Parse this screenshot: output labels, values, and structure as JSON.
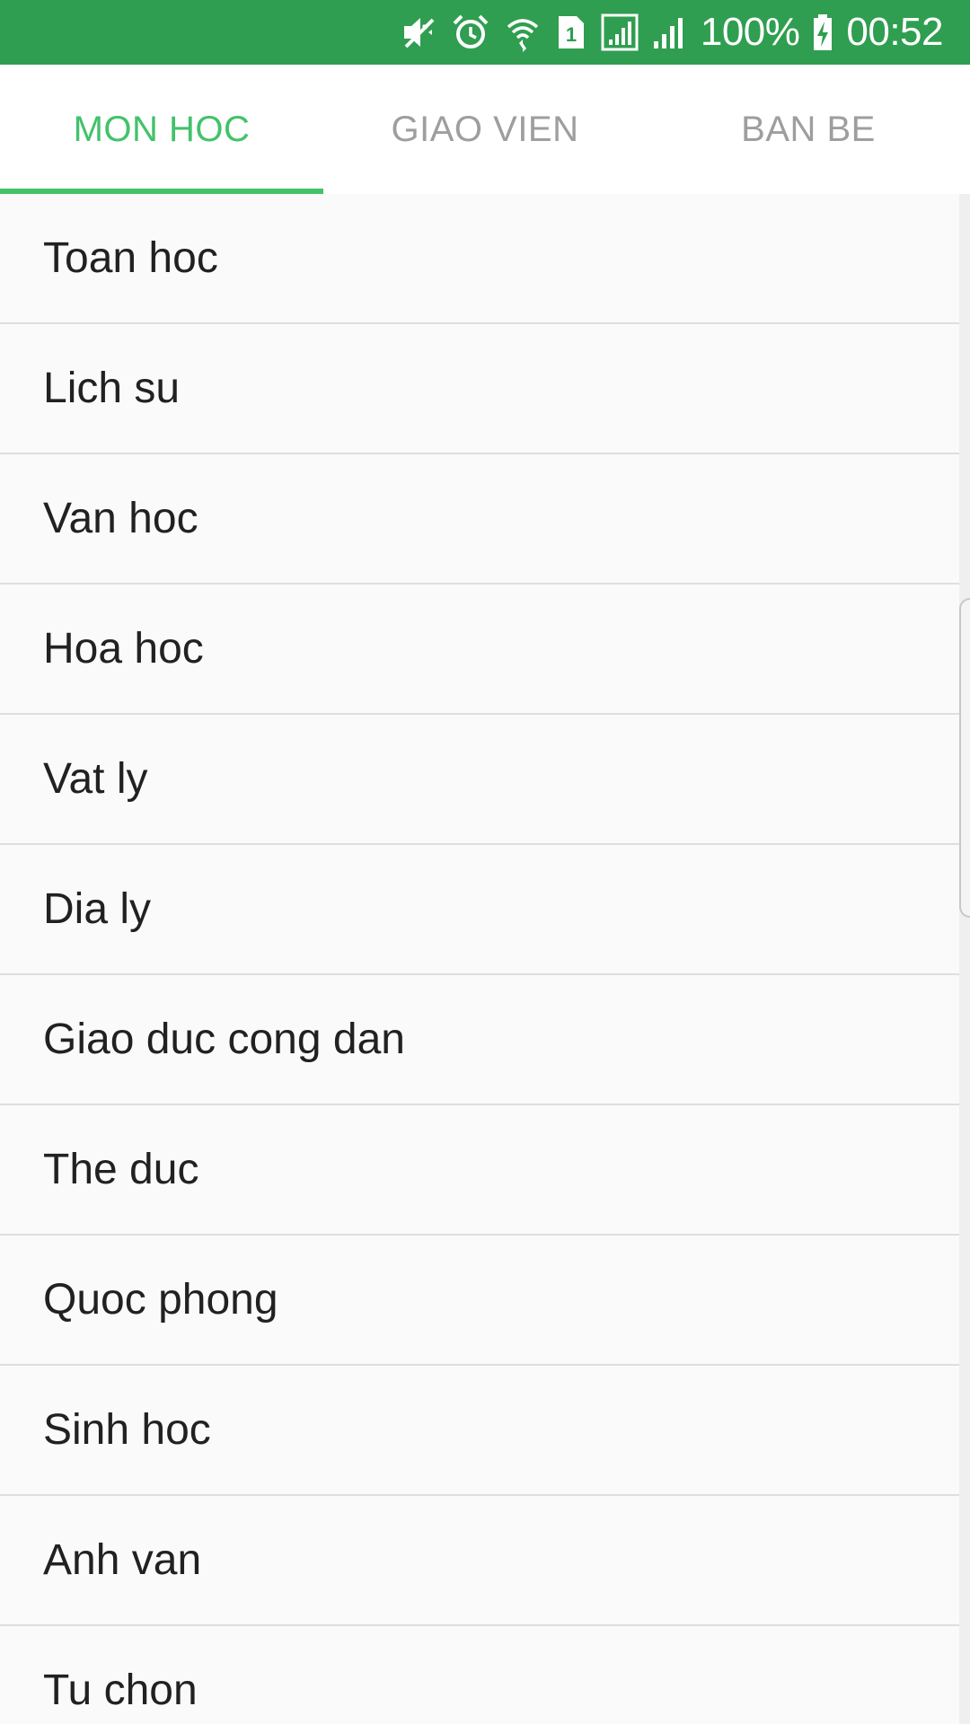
{
  "status_bar": {
    "icons": [
      "vibrate-mute-icon",
      "alarm-icon",
      "wifi-icon",
      "sim-1-icon",
      "signal-icon",
      "signal-icon"
    ],
    "battery_percent": "100%",
    "time": "00:52",
    "background_color": "#2f9e50"
  },
  "tabs": [
    {
      "label": "MON HOC",
      "active": true
    },
    {
      "label": "GIAO VIEN",
      "active": false
    },
    {
      "label": "BAN BE",
      "active": false
    }
  ],
  "accent_color": "#43c26a",
  "subjects": [
    "Toan hoc",
    "Lich su",
    "Van hoc",
    "Hoa hoc",
    "Vat ly",
    "Dia ly",
    "Giao duc cong dan",
    "The duc",
    "Quoc phong",
    "Sinh hoc",
    "Anh van",
    "Tu chon"
  ]
}
